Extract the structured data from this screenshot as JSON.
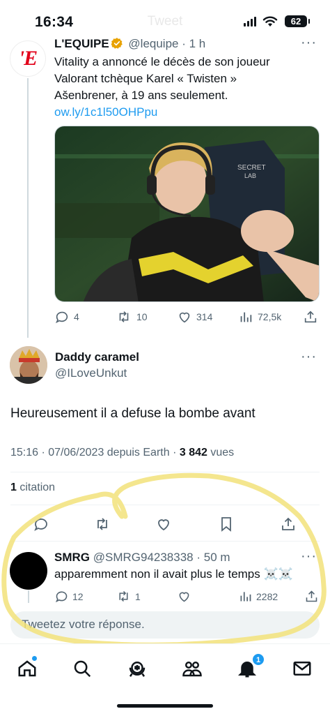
{
  "status_bar": {
    "time": "16:34",
    "ghost_title": "Tweet",
    "battery": "62"
  },
  "quoted_tweet": {
    "author_name": "L'EQUIPE",
    "handle": "@lequipe",
    "time": "1 h",
    "logo_text": "'E",
    "text": "Vitality a annoncé le décès de son joueur Valorant tchèque Karel « Twisten » Ašenbrener, à 19 ans seulement. ",
    "link": "ow.ly/1c1l50OHPpu",
    "stats": {
      "replies": "4",
      "retweets": "10",
      "likes": "314",
      "views": "72,5k"
    }
  },
  "main_tweet": {
    "author_name": "Daddy caramel",
    "handle": "@ILoveUnkut",
    "text": "Heureusement il a defuse la bombe avant",
    "timestamp": "15:16 · 07/06/2023 depuis Earth · ",
    "views_count": "3 842",
    "views_label": " vues",
    "quotes_count": "1",
    "quotes_label": " citation"
  },
  "reply": {
    "author_name": "SMRG",
    "handle": "@SMRG94238338",
    "time": "50 m",
    "text": "apparemment non il avait plus le temps ☠️☠️",
    "stats": {
      "replies": "12",
      "retweets": "1",
      "likes": "",
      "views": "2282"
    }
  },
  "composer": {
    "placeholder": "Tweetez votre réponse."
  },
  "tab_bar": {
    "notification_count": "1",
    "icons": [
      "home-icon",
      "search-icon",
      "spaces-icon",
      "communities-icon",
      "bell-icon",
      "mail-icon"
    ]
  },
  "colors": {
    "accent": "#1d9bf0",
    "lequipe_red": "#e2001a",
    "highlight": "#f2e27a"
  }
}
